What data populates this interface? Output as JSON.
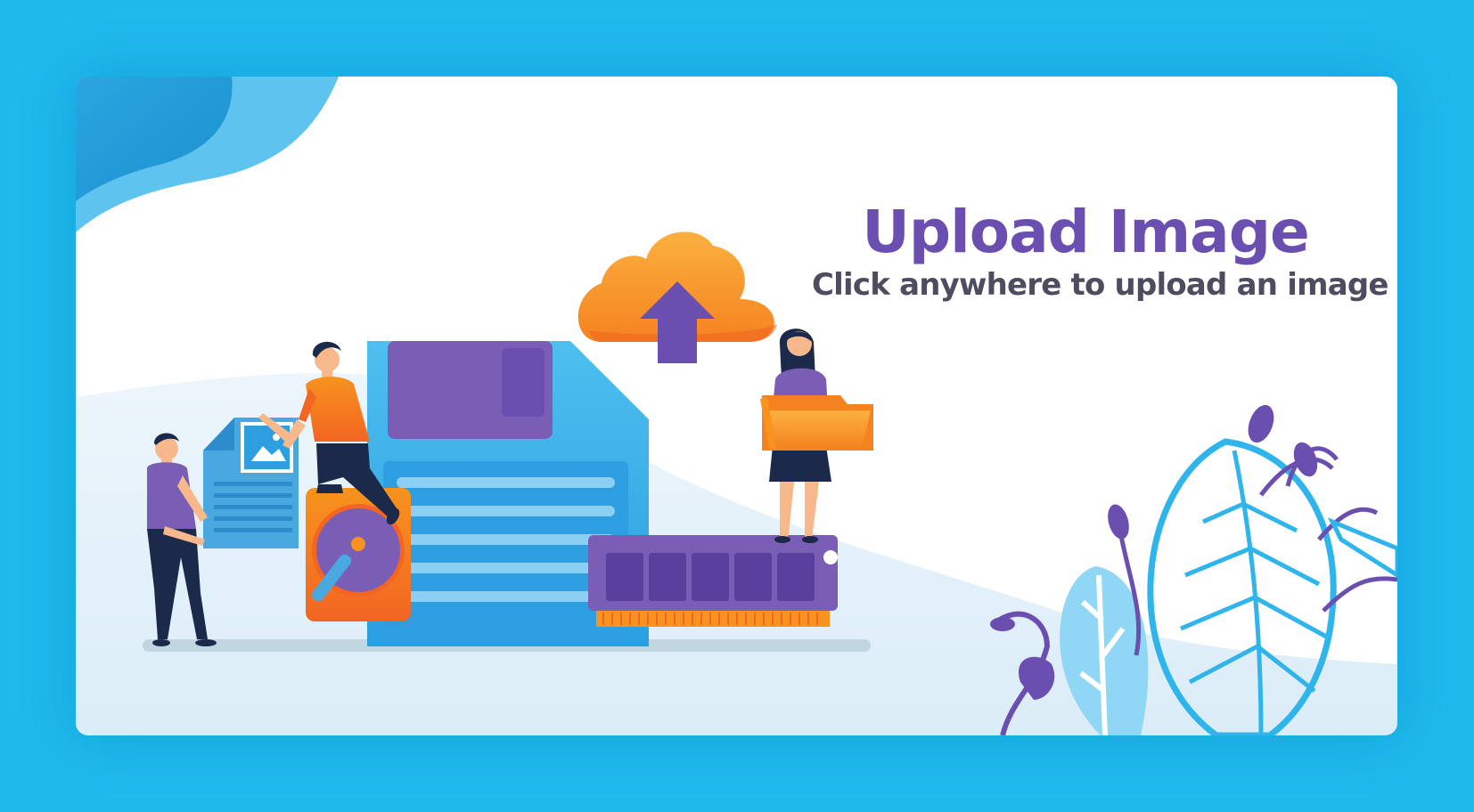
{
  "upload": {
    "title": "Upload Image",
    "subtitle": "Click anywhere to upload an image"
  },
  "colors": {
    "background": "#1fb9ec",
    "card": "#ffffff",
    "title": "#6a4fb0",
    "subtitle": "#4e4d60",
    "accent_orange": "#f7941d",
    "accent_purple": "#6a4fb0",
    "accent_blue": "#3cb8ec"
  },
  "icons": [
    "cloud-upload-icon",
    "floppy-disk-icon",
    "hard-drive-icon",
    "memory-module-icon",
    "image-document-icon",
    "folder-icon",
    "leaf-icon"
  ]
}
